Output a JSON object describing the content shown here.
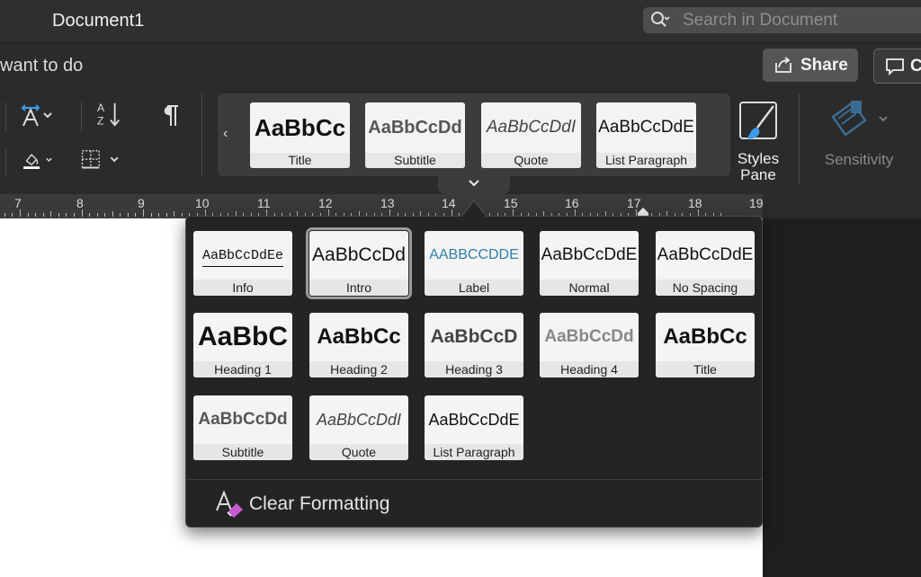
{
  "window": {
    "title": "Document1"
  },
  "search": {
    "placeholder": "Search in Document",
    "icon": "search-icon"
  },
  "tellme": {
    "text": "want to do"
  },
  "toolbar": {
    "share_label": "Share",
    "comments_label": "C"
  },
  "ribbon": {
    "gallery": [
      {
        "name": "Title",
        "sample": "AaBbCc"
      },
      {
        "name": "Subtitle",
        "sample": "AaBbCcDd"
      },
      {
        "name": "Quote",
        "sample": "AaBbCcDdI"
      },
      {
        "name": "List Paragraph",
        "sample": "AaBbCcDdE"
      }
    ],
    "gallery_scroll_left": "‹",
    "expand_icon": "⌄",
    "styles_pane_label": "Styles\nPane",
    "sensitivity_label": "Sensitivity"
  },
  "ruler": {
    "numbers": [
      "7",
      "8",
      "9",
      "10",
      "11",
      "12",
      "13",
      "14",
      "15",
      "16",
      "17",
      "18",
      "19"
    ]
  },
  "styles_menu": {
    "styles": [
      {
        "name": "Info",
        "sample": "AaBbCcDdEe"
      },
      {
        "name": "Intro",
        "sample": "AaBbCcDd",
        "selected": true
      },
      {
        "name": "Label",
        "sample": "AABBCCDDE"
      },
      {
        "name": "Normal",
        "sample": "AaBbCcDdE"
      },
      {
        "name": "No Spacing",
        "sample": "AaBbCcDdE"
      },
      {
        "name": "Heading 1",
        "sample": "AaBbC"
      },
      {
        "name": "Heading 2",
        "sample": "AaBbCc"
      },
      {
        "name": "Heading 3",
        "sample": "AaBbCcD"
      },
      {
        "name": "Heading 4",
        "sample": "AaBbCcDd"
      },
      {
        "name": "Title",
        "sample": "AaBbCc"
      },
      {
        "name": "Subtitle",
        "sample": "AaBbCcDd"
      },
      {
        "name": "Quote",
        "sample": "AaBbCcDdI"
      },
      {
        "name": "List Paragraph",
        "sample": "AaBbCcDdE"
      }
    ],
    "clear_formatting_label": "Clear Formatting"
  },
  "colors": {
    "label_style": "#2f7fa8",
    "selection_outline": "#9a9a9a",
    "eraser": "#c75bd6"
  }
}
